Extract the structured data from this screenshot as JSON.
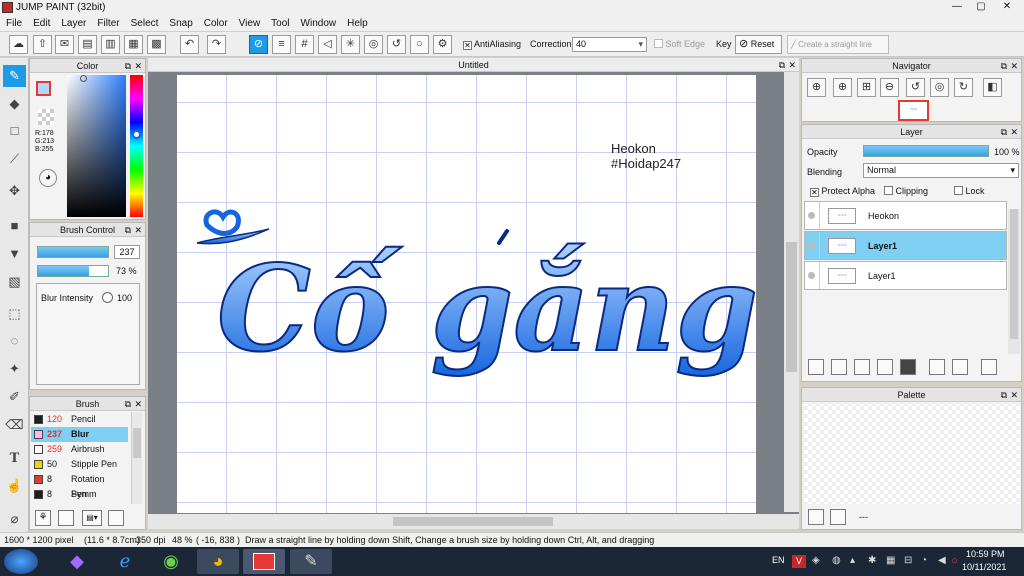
{
  "window": {
    "title": "JUMP PAINT (32bit)"
  },
  "menu": [
    "File",
    "Edit",
    "Layer",
    "Filter",
    "Select",
    "Snap",
    "Color",
    "View",
    "Tool",
    "Window",
    "Help"
  ],
  "toolbar": {
    "antialiasing_label": "AntiAliasing",
    "correction_label": "Correction",
    "correction_value": "40",
    "soft_edge_label": "Soft Edge",
    "key_label": "Key",
    "reset_label": "Reset",
    "straight_line_label": "Create a straight line"
  },
  "color_panel": {
    "title": "Color",
    "r": "R:178",
    "g": "G:213",
    "b": "B:255"
  },
  "brush_control": {
    "title": "Brush Control",
    "size_value": "237",
    "opacity_value": "73 %",
    "blur_label": "Blur Intensity",
    "blur_value": "100"
  },
  "brush_panel": {
    "title": "Brush",
    "items": [
      {
        "num": "120",
        "label": "Pencil",
        "swatch": "#1e1e1e"
      },
      {
        "num": "237",
        "label": "Blur",
        "swatch": "#ffb6f0"
      },
      {
        "num": "259",
        "label": "Airbrush",
        "swatch": "#ffffff"
      },
      {
        "num": "50",
        "label": "Stipple Pen",
        "swatch": "#e6d800"
      },
      {
        "num": "8",
        "label": "Rotation Symm",
        "swatch": "#e53935"
      },
      {
        "num": "8",
        "label": "Pen",
        "swatch": "#1e1e1e"
      }
    ]
  },
  "canvas": {
    "tab_title": "Untitled",
    "text_line1": "Heokon",
    "text_line2": "#Hoidap247",
    "main_text": "Cố gắng"
  },
  "navigator": {
    "title": "Navigator"
  },
  "layer_panel": {
    "title": "Layer",
    "opacity_label": "Opacity",
    "opacity_value": "100 %",
    "blending_label": "Blending",
    "blending_value": "Normal",
    "protect_alpha": "Protect Alpha",
    "clipping": "Clipping",
    "lock": "Lock",
    "layers": [
      {
        "name": "Heokon"
      },
      {
        "name": "Layer1"
      },
      {
        "name": "Layer1"
      }
    ]
  },
  "palette": {
    "title": "Palette",
    "dots": "---"
  },
  "status": {
    "size": "1600 * 1200 pixel",
    "cm": "(11.6 * 8.7cm)",
    "dpi": "350 dpi",
    "zoom": "48 %",
    "coords": "( -16, 838 )",
    "hint": "Draw a straight line by holding down Shift, Change a brush size by holding down Ctrl, Alt, and dragging"
  },
  "taskbar": {
    "lang": "EN",
    "time": "10:59 PM",
    "date": "10/11/2021"
  },
  "colors": {
    "accent": "#1e9be6",
    "selected_layer": "#7fcff3",
    "letter_top": "#b2d5ff",
    "letter_bottom": "#1565e0"
  }
}
